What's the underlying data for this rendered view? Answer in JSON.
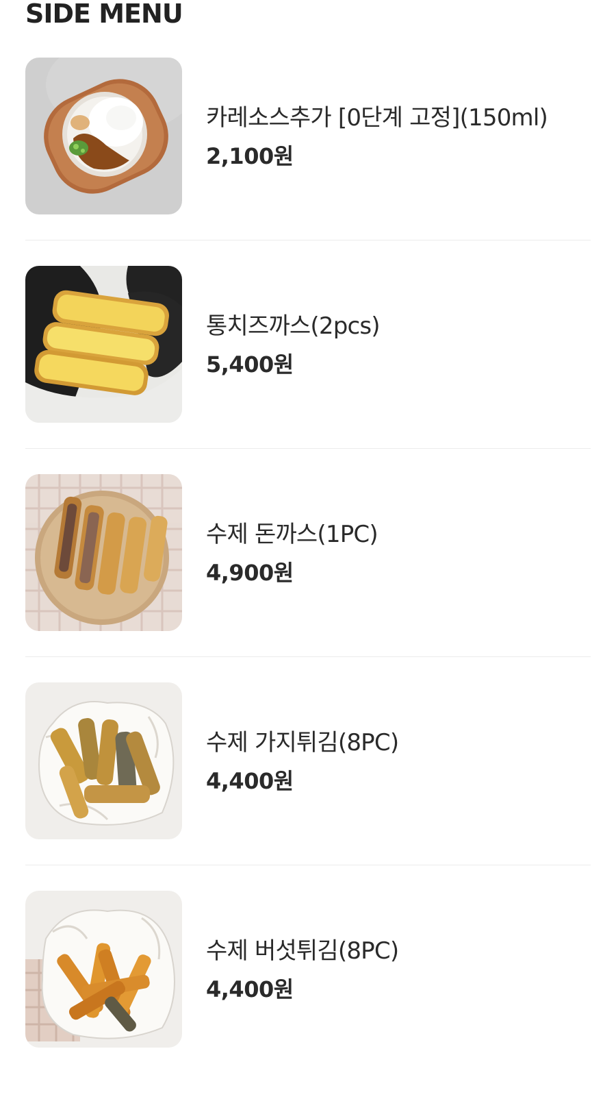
{
  "section": {
    "title": "SIDE MENU"
  },
  "items": [
    {
      "name": "카레소스추가 [0단계 고정](150ml)",
      "price": "2,100원",
      "image_icon": "curry-rice-photo"
    },
    {
      "name": "통치즈까스(2pcs)",
      "price": "5,400원",
      "image_icon": "cheese-cutlet-photo"
    },
    {
      "name": "수제 돈까스(1PC)",
      "price": "4,900원",
      "image_icon": "pork-cutlet-photo"
    },
    {
      "name": "수제 가지튀김(8PC)",
      "price": "4,400원",
      "image_icon": "fried-eggplant-photo"
    },
    {
      "name": "수제 버섯튀김(8PC)",
      "price": "4,400원",
      "image_icon": "fried-mushroom-photo"
    }
  ],
  "colors": {
    "text": "#2a2a2a",
    "divider": "#ececec",
    "background": "#ffffff"
  }
}
